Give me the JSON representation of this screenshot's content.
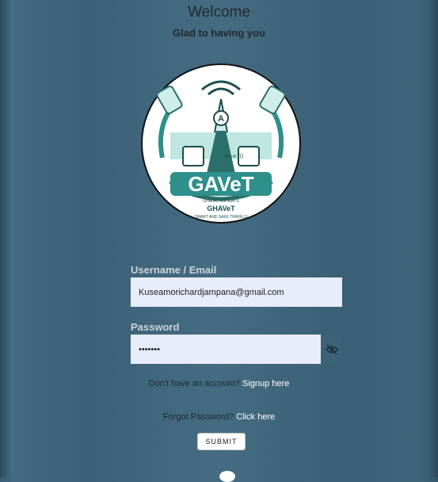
{
  "header": {
    "title": "Welcome",
    "subtitle": "Glad to having you"
  },
  "logo": {
    "name": "GAVeT",
    "line1": "GHANA HIGHWAYS",
    "line2": "GHAVeT",
    "line3": "SMART AND SAFE TRAVELS",
    "plate": "GH-4-TD"
  },
  "form": {
    "username_label": "Username / Email",
    "username_value": "Kuseamorichardjampana@gmail.com",
    "password_label": "Password",
    "password_value": "•••••••",
    "toggle_icon": "eye-slash-icon"
  },
  "links": {
    "signup_prompt": "Don't have an account?",
    "signup_link": "Signup here",
    "forgot_prompt": "Forgot Password?",
    "forgot_link": "Click here"
  },
  "submit_label": "SUBMIT",
  "colors": {
    "background": "#41697f",
    "input_bg": "#e8edfb",
    "link": "#ffffff",
    "logo_teal": "#2f8f8a"
  }
}
